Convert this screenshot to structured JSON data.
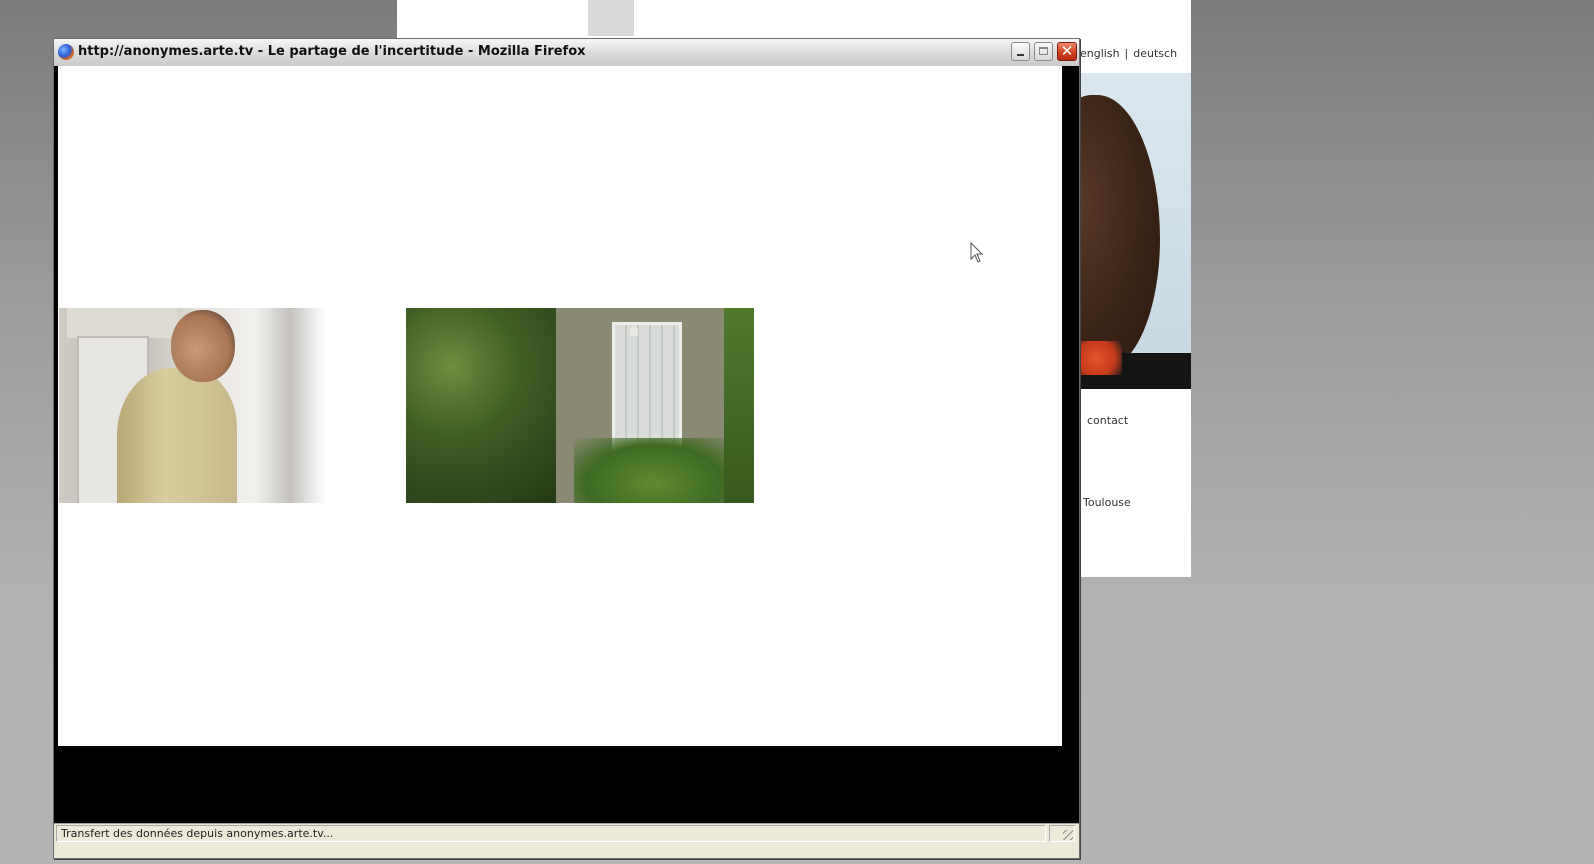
{
  "background_page": {
    "lang_english": "english",
    "lang_separator": "|",
    "lang_deutsch": "deutsch",
    "contact_label": "contact",
    "city_label": "Toulouse"
  },
  "window": {
    "title": "http://anonymes.arte.tv - Le partage de l'incertitude - Mozilla Firefox",
    "minimize_label": "minimize",
    "maximize_label": "maximize",
    "close_glyph": "✕"
  },
  "content": {
    "thumbnails": [
      {
        "name": "man-in-hallway"
      },
      {
        "name": "house-window-garden"
      }
    ]
  },
  "status_bar": {
    "text": "Transfert des données depuis anonymes.arte.tv..."
  },
  "colors": {
    "content_bg": "#ffffff",
    "letterbox": "#000000",
    "close_button": "#d34120"
  },
  "icons": [
    "firefox-logo-icon",
    "minimize-icon",
    "maximize-icon",
    "close-icon",
    "mouse-cursor-icon",
    "resize-grip-icon"
  ]
}
